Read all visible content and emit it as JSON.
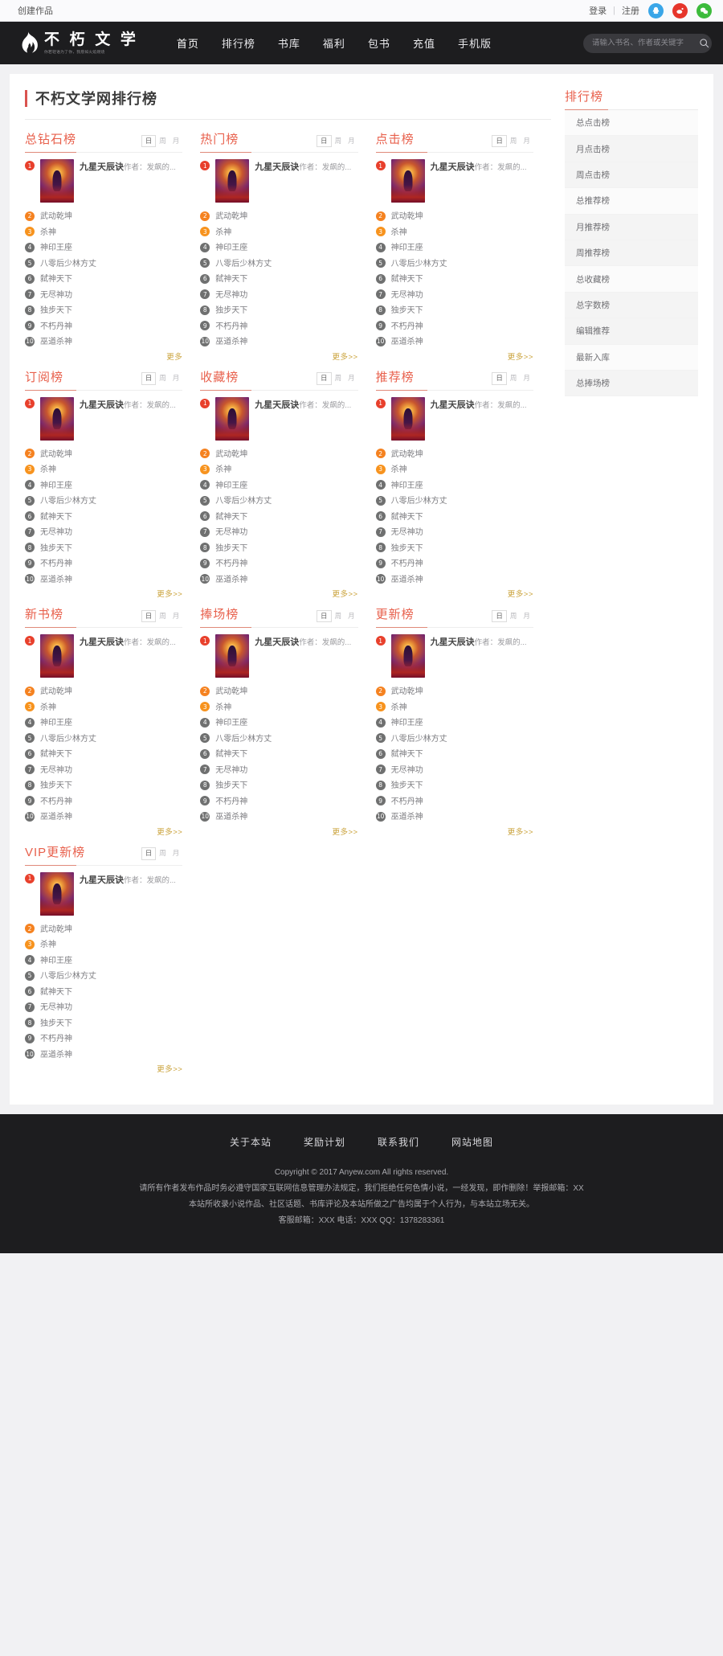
{
  "topbar": {
    "create_label": "创建作品",
    "login_label": "登录",
    "separator": "|",
    "register_label": "注册",
    "social": [
      {
        "name": "qq-icon",
        "color": "#3aa6e8"
      },
      {
        "name": "weibo-icon",
        "color": "#e6352b"
      },
      {
        "name": "wechat-icon",
        "color": "#3cbb3c"
      }
    ]
  },
  "header": {
    "brand_name": "不 朽 文 学",
    "brand_tagline": "你若轻语为了你，我愿如火焰燃烧",
    "nav": [
      "首页",
      "排行榜",
      "书库",
      "福利",
      "包书",
      "充值",
      "手机版"
    ],
    "search_placeholder": "请输入书名、作者或关键字"
  },
  "main": {
    "page_title": "不朽文学网排行榜",
    "tabs": [
      "日",
      "周",
      "月"
    ],
    "more_first": "更多",
    "more_label": "更多>>",
    "top_book": {
      "title": "九星天辰诀",
      "author": "作者：发飙的..."
    },
    "list_items": [
      "武动乾坤",
      "杀神",
      "神印王座",
      "八零后少林方丈",
      "弑神天下",
      "无尽神功",
      "独步天下",
      "不朽丹神",
      "巫道杀神"
    ],
    "boards": [
      {
        "title": "总钻石榜",
        "more": "更多"
      },
      {
        "title": "热门榜",
        "more": "更多>>"
      },
      {
        "title": "点击榜",
        "more": "更多>>"
      },
      {
        "title": "订阅榜",
        "more": "更多>>"
      },
      {
        "title": "收藏榜",
        "more": "更多>>"
      },
      {
        "title": "推荐榜",
        "more": "更多>>"
      },
      {
        "title": "新书榜",
        "more": "更多>>"
      },
      {
        "title": "捧场榜",
        "more": "更多>>"
      },
      {
        "title": "更新榜",
        "more": "更多>>"
      },
      {
        "title": "VIP更新榜",
        "more": "更多>>"
      }
    ]
  },
  "aside": {
    "title": "排行榜",
    "items": [
      "总点击榜",
      "月点击榜",
      "周点击榜",
      "总推荐榜",
      "月推荐榜",
      "周推荐榜",
      "总收藏榜",
      "总字数榜",
      "编辑推荐",
      "最新入库",
      "总捧场榜"
    ]
  },
  "footer": {
    "nav": [
      "关于本站",
      "奖励计划",
      "联系我们",
      "网站地图"
    ],
    "copyright": "Copyright © 2017 Anyew.com All rights reserved.",
    "line1": "请所有作者发布作品时务必遵守国家互联网信息管理办法规定，我们拒绝任何色情小说，一经发现，即作删除！举报邮箱：XX",
    "line2": "本站所收录小说作品、社区话题、书库评论及本站所做之广告均属于个人行为，与本站立场无关。",
    "line3": "客服邮箱：XXX 电话：XXX QQ：1378283361"
  },
  "colors": {
    "accent": "#e8604c",
    "brand_dark": "#1d1d1f",
    "rank1": "#e8402c",
    "rank2": "#f58220",
    "rank3": "#f7931e",
    "rank_other": "#6f7070",
    "more_link": "#caa23a"
  }
}
